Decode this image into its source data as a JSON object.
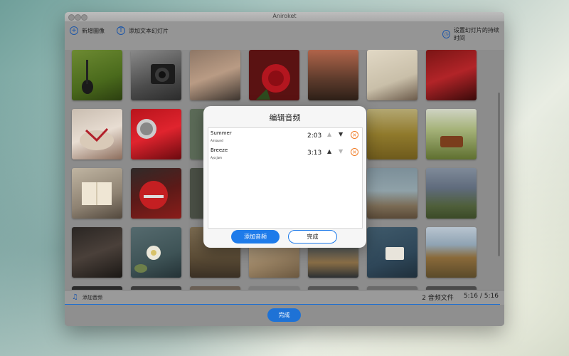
{
  "window": {
    "title": "Aniroket"
  },
  "toolbar": {
    "add_image": "新增圖像",
    "add_text_slide": "添加文本幻灯片",
    "set_duration": "设置幻灯片的持续时间"
  },
  "audio_bar": {
    "label": "添加音频",
    "file_count": "2 音频文件",
    "time": "5:16 / 5:16"
  },
  "footer": {
    "done_label": "完成"
  },
  "dialog": {
    "title": "编辑音频",
    "tracks": [
      {
        "name": "Summer",
        "artist": "Airsound",
        "duration": "2:03"
      },
      {
        "name": "Breeze",
        "artist": "Aya Jam",
        "duration": "3:13"
      }
    ],
    "add_audio_label": "添加音频",
    "done_label": "完成"
  },
  "icons": {
    "add_image": "plus-circle-icon",
    "add_text": "text-circle-icon",
    "duration": "clock-icon",
    "audio": "music-note-icon",
    "move_up": "chevron-up-icon",
    "move_down": "chevron-down-icon",
    "remove": "close-circle-icon"
  },
  "colors": {
    "accent": "#1e72d6",
    "remove": "#f07a23"
  }
}
